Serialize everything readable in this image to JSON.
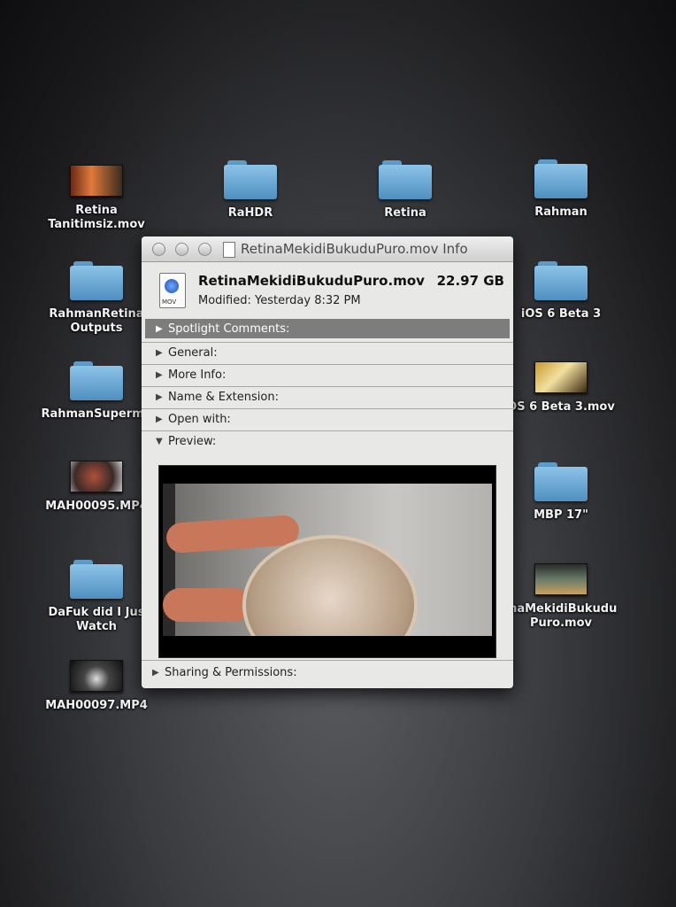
{
  "desktop": {
    "icons": [
      {
        "label": "Retina\nTanitimsiz.mov",
        "icon": "movie-thumbnail"
      },
      {
        "label": "RaHDR",
        "icon": "folder-icon"
      },
      {
        "label": "Retina",
        "icon": "folder-icon"
      },
      {
        "label": "Rahman",
        "icon": "folder-icon"
      },
      {
        "label": "RahmanRetina\nOutputs",
        "icon": "folder-icon"
      },
      {
        "label": "iOS 6 Beta 3",
        "icon": "folder-icon"
      },
      {
        "label": "RahmanSuperma",
        "icon": "folder-icon"
      },
      {
        "label": "OS 6 Beta 3.mov",
        "icon": "movie-thumbnail"
      },
      {
        "label": "MAH00095.MP4",
        "icon": "movie-thumbnail"
      },
      {
        "label": "MBP 17\"",
        "icon": "folder-icon"
      },
      {
        "label": "DaFuk did I Jus\nWatch",
        "icon": "folder-icon"
      },
      {
        "label": "inaMekidiBukudu\nPuro.mov",
        "icon": "movie-thumbnail"
      },
      {
        "label": "MAH00097.MP4",
        "icon": "movie-thumbnail"
      }
    ]
  },
  "info_window": {
    "title": "RetinaMekidiBukuduPuro.mov Info",
    "file_name": "RetinaMekidiBukuduPuro.mov",
    "file_size": "22.97 GB",
    "modified": "Modified: Yesterday 8:32 PM",
    "file_icon_ext": "MOV",
    "sections": {
      "spotlight": "Spotlight Comments:",
      "general": "General:",
      "more_info": "More Info:",
      "name_ext": "Name & Extension:",
      "open_with": "Open with:",
      "preview": "Preview:",
      "sharing": "Sharing & Permissions:"
    }
  }
}
